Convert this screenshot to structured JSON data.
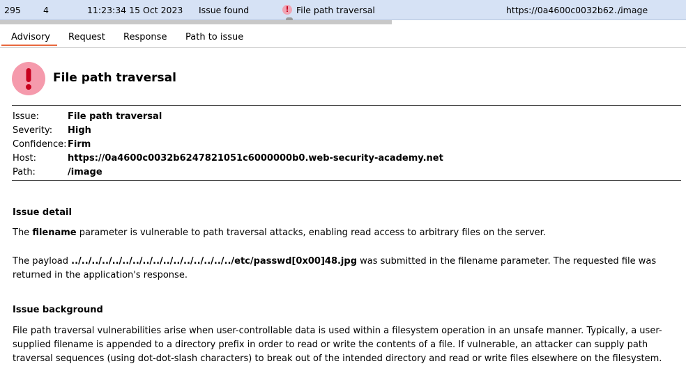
{
  "issue_row": {
    "number": "295",
    "index": "4",
    "time": "11:23:34 15 Oct 2023",
    "action": "Issue found",
    "issue_name": "File path traversal",
    "host": "https://0a4600c0032b62...",
    "path": "/image"
  },
  "tabs": [
    {
      "label": "Advisory"
    },
    {
      "label": "Request"
    },
    {
      "label": "Response"
    },
    {
      "label": "Path to issue"
    }
  ],
  "advisory": {
    "title": "File path traversal",
    "fields": [
      {
        "label": "Issue:",
        "value": "File path traversal"
      },
      {
        "label": "Severity:",
        "value": "High"
      },
      {
        "label": "Confidence:",
        "value": "Firm"
      },
      {
        "label": "Host:",
        "value": "https://0a4600c0032b6247821051c6000000b0.web-security-academy.net"
      },
      {
        "label": "Path:",
        "value": "/image"
      }
    ],
    "detail_heading": "Issue detail",
    "detail_p1_pre": "The ",
    "detail_p1_bold": "filename",
    "detail_p1_post": " parameter is vulnerable to path traversal attacks, enabling read access to arbitrary files on the server.",
    "detail_p2_pre": "The payload ",
    "detail_p2_bold": "../../../../../../../../../../../../../../../../etc/passwd[0x00]48.jpg",
    "detail_p2_post": " was submitted in the filename parameter. The requested file was returned in the application's response.",
    "background_heading": "Issue background",
    "background_p": "File path traversal vulnerabilities arise when user-controllable data is used within a filesystem operation in an unsafe manner. Typically, a user-supplied filename is appended to a directory prefix in order to read or write the contents of a file. If vulnerable, an attacker can supply path traversal sequences (using dot-dot-slash characters) to break out of the intended directory and read or write files elsewhere on the filesystem."
  },
  "colors": {
    "accent": "#e8673c",
    "row_highlight": "#d6e2f5",
    "severity_icon": "#f59aac"
  }
}
